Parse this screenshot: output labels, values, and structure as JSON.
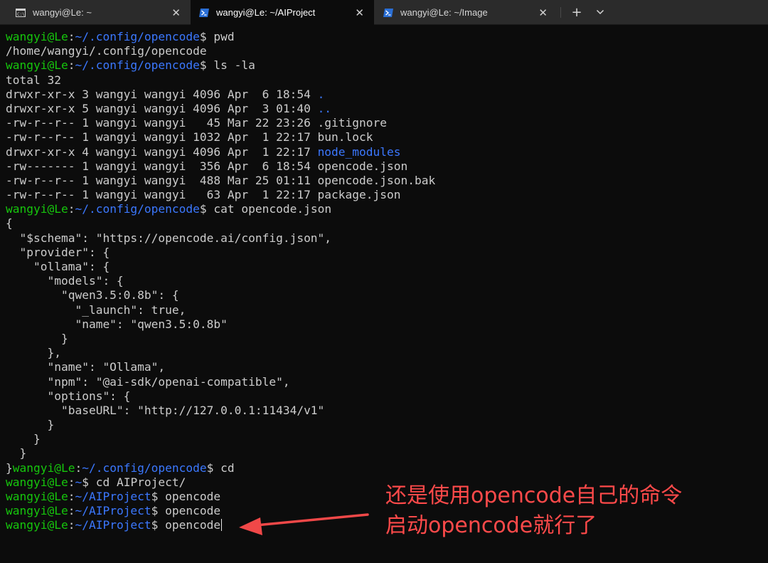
{
  "tabs": [
    {
      "title": "wangyi@Le: ~",
      "icon": "cmd-icon",
      "active": false
    },
    {
      "title": "wangyi@Le: ~/AIProject",
      "icon": "powershell-icon",
      "active": true
    },
    {
      "title": "wangyi@Le: ~/Image",
      "icon": "powershell-icon",
      "active": false
    }
  ],
  "tab_close_glyph": "✕",
  "new_tab_glyph": "+",
  "dropdown_glyph": "⌄",
  "colors": {
    "background": "#0c0c0c",
    "prompt_user": "#16c60c",
    "prompt_path": "#3b78ff",
    "text": "#cccccc",
    "annotation": "#ff4a4a"
  },
  "terminal_lines": [
    [
      {
        "t": "wangyi@Le",
        "c": "u"
      },
      {
        "t": ":"
      },
      {
        "t": "~/.config/opencode",
        "c": "p"
      },
      {
        "t": "$ pwd"
      }
    ],
    [
      {
        "t": "/home/wangyi/.config/opencode"
      }
    ],
    [
      {
        "t": "wangyi@Le",
        "c": "u"
      },
      {
        "t": ":"
      },
      {
        "t": "~/.config/opencode",
        "c": "p"
      },
      {
        "t": "$ ls -la"
      }
    ],
    [
      {
        "t": "total 32"
      }
    ],
    [
      {
        "t": "drwxr-xr-x 3 wangyi wangyi 4096 Apr  6 18:54 "
      },
      {
        "t": ".",
        "c": "p"
      }
    ],
    [
      {
        "t": "drwxr-xr-x 5 wangyi wangyi 4096 Apr  3 01:40 "
      },
      {
        "t": "..",
        "c": "p"
      }
    ],
    [
      {
        "t": "-rw-r--r-- 1 wangyi wangyi   45 Mar 22 23:26 .gitignore"
      }
    ],
    [
      {
        "t": "-rw-r--r-- 1 wangyi wangyi 1032 Apr  1 22:17 bun.lock"
      }
    ],
    [
      {
        "t": "drwxr-xr-x 4 wangyi wangyi 4096 Apr  1 22:17 "
      },
      {
        "t": "node_modules",
        "c": "p"
      }
    ],
    [
      {
        "t": "-rw------- 1 wangyi wangyi  356 Apr  6 18:54 opencode.json"
      }
    ],
    [
      {
        "t": "-rw-r--r-- 1 wangyi wangyi  488 Mar 25 01:11 opencode.json.bak"
      }
    ],
    [
      {
        "t": "-rw-r--r-- 1 wangyi wangyi   63 Apr  1 22:17 package.json"
      }
    ],
    [
      {
        "t": "wangyi@Le",
        "c": "u"
      },
      {
        "t": ":"
      },
      {
        "t": "~/.config/opencode",
        "c": "p"
      },
      {
        "t": "$ cat opencode.json"
      }
    ],
    [
      {
        "t": "{"
      }
    ],
    [
      {
        "t": "  \"$schema\": \"https://opencode.ai/config.json\","
      }
    ],
    [
      {
        "t": "  \"provider\": {"
      }
    ],
    [
      {
        "t": "    \"ollama\": {"
      }
    ],
    [
      {
        "t": "      \"models\": {"
      }
    ],
    [
      {
        "t": "        \"qwen3.5:0.8b\": {"
      }
    ],
    [
      {
        "t": "          \"_launch\": true,"
      }
    ],
    [
      {
        "t": "          \"name\": \"qwen3.5:0.8b\""
      }
    ],
    [
      {
        "t": "        }"
      }
    ],
    [
      {
        "t": "      },"
      }
    ],
    [
      {
        "t": "      \"name\": \"Ollama\","
      }
    ],
    [
      {
        "t": "      \"npm\": \"@ai-sdk/openai-compatible\","
      }
    ],
    [
      {
        "t": "      \"options\": {"
      }
    ],
    [
      {
        "t": "        \"baseURL\": \"http://127.0.0.1:11434/v1\""
      }
    ],
    [
      {
        "t": "      }"
      }
    ],
    [
      {
        "t": "    }"
      }
    ],
    [
      {
        "t": "  }"
      }
    ],
    [
      {
        "t": "}"
      },
      {
        "t": "wangyi@Le",
        "c": "u"
      },
      {
        "t": ":"
      },
      {
        "t": "~/.config/opencode",
        "c": "p"
      },
      {
        "t": "$ cd"
      }
    ],
    [
      {
        "t": "wangyi@Le",
        "c": "u"
      },
      {
        "t": ":"
      },
      {
        "t": "~",
        "c": "p"
      },
      {
        "t": "$ cd AIProject/"
      }
    ],
    [
      {
        "t": "wangyi@Le",
        "c": "u"
      },
      {
        "t": ":"
      },
      {
        "t": "~/AIProject",
        "c": "p"
      },
      {
        "t": "$ opencode"
      }
    ],
    [
      {
        "t": "wangyi@Le",
        "c": "u"
      },
      {
        "t": ":"
      },
      {
        "t": "~/AIProject",
        "c": "p"
      },
      {
        "t": "$ opencode"
      }
    ],
    [
      {
        "t": "wangyi@Le",
        "c": "u"
      },
      {
        "t": ":"
      },
      {
        "t": "~/AIProject",
        "c": "p"
      },
      {
        "t": "$ opencode"
      }
    ]
  ],
  "annotation": {
    "line1": "还是使用opencode自己的命令",
    "line2": "启动opencode就行了"
  }
}
